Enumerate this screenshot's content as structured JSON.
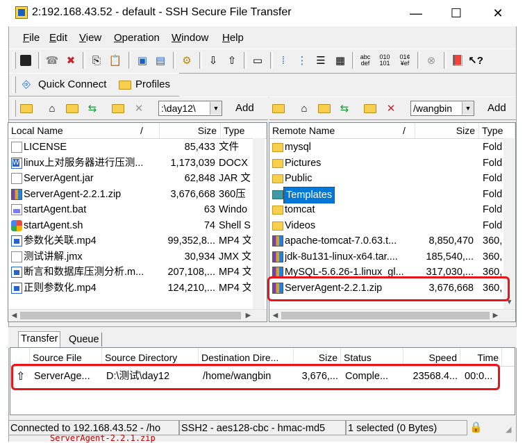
{
  "window": {
    "title": "2:192.168.43.52 - default - SSH Secure File Transfer",
    "minimize": "—",
    "maximize": "☐",
    "close": "✕"
  },
  "menu": [
    "File",
    "Edit",
    "View",
    "Operation",
    "Window",
    "Help"
  ],
  "quick": {
    "connect": "Quick Connect",
    "profiles": "Profiles"
  },
  "local_nav": {
    "path": ":\\day12\\",
    "add": "Add"
  },
  "remote_nav": {
    "path": "/wangbin",
    "add": "Add"
  },
  "local": {
    "headers": [
      "Local Name",
      "/",
      "Size",
      "Type"
    ],
    "rows": [
      {
        "icon": "file-icon",
        "name": "LICENSE",
        "size": "85,433",
        "type": "文件"
      },
      {
        "icon": "docx-icon",
        "name": "linux上对服务器进行压测...",
        "size": "1,173,039",
        "type": "DOCX"
      },
      {
        "icon": "file-icon",
        "name": "ServerAgent.jar",
        "size": "62,848",
        "type": "JAR 文"
      },
      {
        "icon": "zip-icon",
        "name": "ServerAgent-2.2.1.zip",
        "size": "3,676,668",
        "type": "360压"
      },
      {
        "icon": "bat-icon",
        "name": "startAgent.bat",
        "size": "63",
        "type": "Windo"
      },
      {
        "icon": "sh-icon",
        "name": "startAgent.sh",
        "size": "74",
        "type": "Shell S"
      },
      {
        "icon": "mp4-icon",
        "name": "参数化关联.mp4",
        "size": "99,352,8...",
        "type": "MP4 文"
      },
      {
        "icon": "file-icon",
        "name": "测试讲解.jmx",
        "size": "30,934",
        "type": "JMX 文"
      },
      {
        "icon": "mp4-icon",
        "name": "断言和数据库压测分析.m...",
        "size": "207,108,...",
        "type": "MP4 文"
      },
      {
        "icon": "mp4-icon",
        "name": "正则参数化.mp4",
        "size": "124,210,...",
        "type": "MP4 文"
      }
    ]
  },
  "remote": {
    "headers": [
      "Remote Name",
      "/",
      "Size",
      "Type"
    ],
    "rows": [
      {
        "icon": "folder-icon",
        "name": "mysql",
        "size": "",
        "type": "Fold"
      },
      {
        "icon": "folder-icon",
        "name": "Pictures",
        "size": "",
        "type": "Fold"
      },
      {
        "icon": "folder-icon",
        "name": "Public",
        "size": "",
        "type": "Fold"
      },
      {
        "icon": "folder-icon",
        "name": "Templates",
        "size": "",
        "type": "Fold",
        "selected": true
      },
      {
        "icon": "folder-icon",
        "name": "tomcat",
        "size": "",
        "type": "Fold"
      },
      {
        "icon": "folder-icon",
        "name": "Videos",
        "size": "",
        "type": "Fold"
      },
      {
        "icon": "zip-icon",
        "name": "apache-tomcat-7.0.63.t...",
        "size": "8,850,470",
        "type": "360,"
      },
      {
        "icon": "zip-icon",
        "name": "jdk-8u131-linux-x64.tar....",
        "size": "185,540,...",
        "type": "360,"
      },
      {
        "icon": "zip-icon",
        "name": "MySQL-5.6.26-1.linux_gl...",
        "size": "317,030,...",
        "type": "360,"
      },
      {
        "icon": "zip-icon",
        "name": "ServerAgent-2.2.1.zip",
        "size": "3,676,668",
        "type": "360,"
      }
    ]
  },
  "tabs": [
    "Transfer",
    "Queue"
  ],
  "transfer": {
    "headers": [
      "",
      "Source File",
      "Source Directory",
      "Destination Dire...",
      "Size",
      "Status",
      "Speed",
      "Time"
    ],
    "rows": [
      {
        "dir": "⇧",
        "file": "ServerAge...",
        "source_dir": "D:\\测试\\day12",
        "dest_dir": "/home/wangbin",
        "size": "3,676,...",
        "status": "Comple...",
        "speed": "23568.4...",
        "time": "00:0..."
      }
    ]
  },
  "status": {
    "connection": "Connected to 192.168.43.52 - /ho",
    "cipher": "SSH2 - aes128-cbc - hmac-md5",
    "selection": "1 selected (0 Bytes)"
  },
  "below_text": "ServerAgent-2.2.1.zip",
  "colors": {
    "highlight": "#e8141b",
    "selection": "#0078d7"
  }
}
